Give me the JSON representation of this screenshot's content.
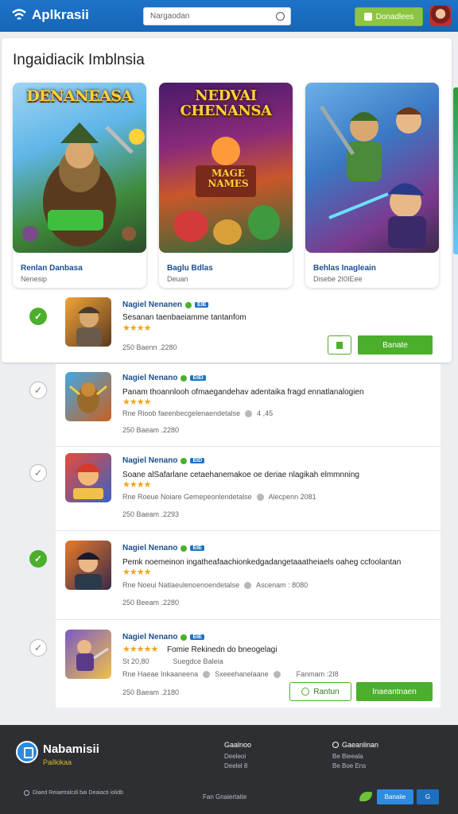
{
  "header": {
    "app_name": "Aplkrasii",
    "search_value": "Nargaodan",
    "download_label": "Donadlees"
  },
  "featured": {
    "title": "Ingaidiacik Imblnsia",
    "cards": [
      {
        "art_title": "DENANEASA",
        "name": "Renlan Danbasa",
        "sub": "Nenesip",
        "colors": [
          "#5fb6e8",
          "#2b6a2b"
        ]
      },
      {
        "art_title": "NEDVAI CHENANSA",
        "name": "Baglu Bdlas",
        "sub": "Deuan",
        "colors": [
          "#6a2a8a",
          "#d9572a"
        ]
      },
      {
        "art_title": "",
        "name": "Behlas Inagleain",
        "sub": "Disebe 2I0IEee",
        "colors": [
          "#3a78c4",
          "#7b3a8f"
        ]
      }
    ],
    "art_subtitle_2": "MAGE NAMES"
  },
  "rows": [
    {
      "title": "Nagiel Nenanen",
      "badge": "EIE",
      "desc": "Sesanan taenbaeiamme tantanfom",
      "stars": "★★★★",
      "footer": "250 Baenn .2280",
      "checked": true,
      "button_primary": "Banate",
      "thumb_colors": [
        "#f2a43a",
        "#5b3a1e"
      ]
    },
    {
      "title": "Nagiel Nenano",
      "badge": "EIEI",
      "desc": "Panam thoannlooh ofmaegandehav adentaika fragd ennatlanalogien",
      "stars": "★★★★",
      "meta_left": "Rne Rioob faeenbecgelenaendetalse",
      "meta_right": "4 ,45",
      "footer": "250 Baeam .2280",
      "checked": false,
      "thumb_colors": [
        "#43a7e3",
        "#c9601e"
      ]
    },
    {
      "title": "Nagiel Nenano",
      "badge": "EID",
      "desc": "Soane alSafarlane cetaehanemakoe oe deriae nlagikah elmmnning",
      "stars": "★★★★",
      "meta_left": "Rne Roeue Noiare Gemepeonlendetalse",
      "meta_right": "Alecpenn 2081",
      "footer": "250 Baeam .2293",
      "checked": false,
      "thumb_colors": [
        "#e84a3a",
        "#3a62c4"
      ]
    },
    {
      "title": "Nagiel Nenano",
      "badge": "EIE",
      "desc": "Pemk noemeinon ingatheafaachionkedgadangetaaatheiaels oaheg ccfoolantan",
      "stars": "★★★★",
      "meta_left": "Rne Noeui Natlaeulenoenoendetalse",
      "meta_right": "Ascenam : 8080",
      "footer": "250 Beeam .2280",
      "checked": true,
      "thumb_colors": [
        "#e87a2a",
        "#3a2a4a"
      ]
    },
    {
      "title": "Nagiel Nenano",
      "badge": "EIE",
      "desc": "Fomie Rekinedn do bneogelagi",
      "stars": "★★★★★",
      "desc2_left": "St 20,80",
      "desc2_right": "Suegdce Baleia",
      "meta_left": "Rne Haeae Inkaaneena",
      "meta_mid": "Sxeeehanelaane",
      "meta_right": "Fanmam :2I8",
      "footer": "250 Baeam .2180",
      "checked": false,
      "button_outline": "Rantun",
      "button_primary": "Inaeantnaen",
      "thumb_colors": [
        "#7a5ac4",
        "#f0c04a"
      ]
    }
  ],
  "footer": {
    "brand": "Nabamisii",
    "tagline": "Pailkikaa",
    "col1": {
      "title": "Gaalnoo",
      "lines": [
        "Deeleoi",
        "Deelel 8"
      ]
    },
    "col2": {
      "title": "Gaeanlinan",
      "lines": [
        "Be Bieeala",
        "Be Boe Ens"
      ]
    },
    "copyright": "Diaed Reiaetralcdi bai Deaiacti iolidb",
    "center": "Fan Gnaiertaite",
    "btn_primary": "Banaiie",
    "btn_secondary": "G"
  }
}
